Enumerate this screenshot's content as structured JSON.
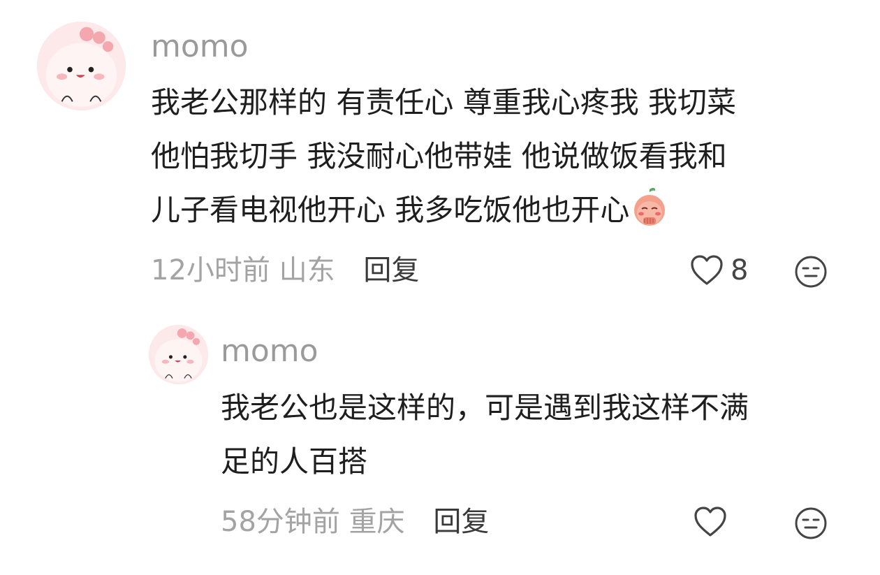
{
  "comments": [
    {
      "username": "momo",
      "avatar_icon": "pink-cartoon-avatar",
      "lines": [
        "我老公那样的 有责任心 尊重我心疼我 我切菜",
        "他怕我切手 我没耐心他带娃 他说做饭看我和",
        "儿子看电视他开心 我多吃饭他也开心"
      ],
      "emoji_icon": "shy-blush-emoji",
      "time": "12小时前",
      "location": "山东",
      "reply_label": "回复",
      "like_count": "8"
    },
    {
      "username": "momo",
      "avatar_icon": "pink-cartoon-avatar",
      "lines": [
        "我老公也是这样的，可是遇到我这样不满",
        "足的人百搭"
      ],
      "time": "58分钟前",
      "location": "重庆",
      "reply_label": "回复"
    }
  ],
  "colors": {
    "username": "#9a9a9a",
    "meta": "#a3a3a3",
    "text": "#1e1e1e",
    "avatar_bg": "#fce6e8"
  }
}
